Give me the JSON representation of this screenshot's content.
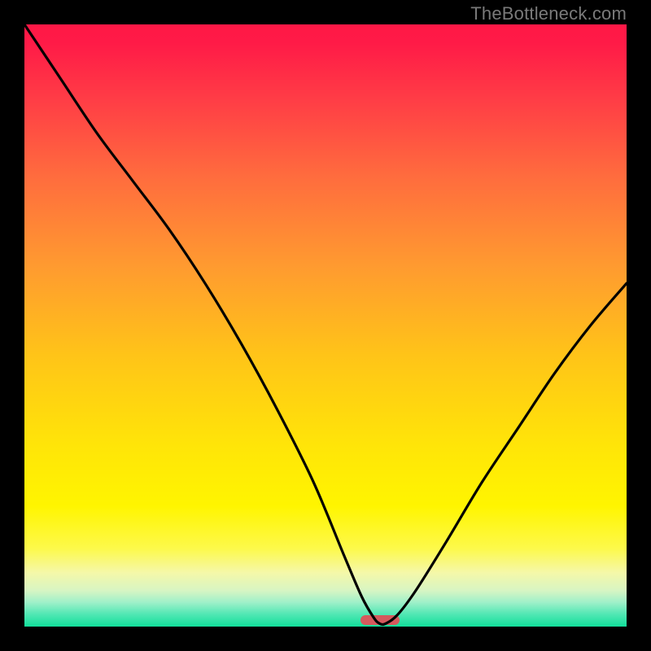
{
  "watermark": "TheBottleneck.com",
  "chart_data": {
    "type": "line",
    "title": "",
    "xlabel": "",
    "ylabel": "",
    "xlim": [
      0,
      100
    ],
    "ylim": [
      0,
      100
    ],
    "grid": false,
    "series": [
      {
        "name": "bottleneck-curve",
        "x": [
          0,
          6,
          12,
          18,
          24,
          30,
          36,
          42,
          48,
          53,
          56,
          58,
          59,
          60,
          62,
          65,
          70,
          76,
          82,
          88,
          94,
          100
        ],
        "y": [
          100,
          91,
          82,
          74,
          66,
          57,
          47,
          36,
          24,
          12,
          5,
          1.5,
          0.5,
          0.5,
          2,
          6,
          14,
          24,
          33,
          42,
          50,
          57
        ]
      }
    ],
    "marker": {
      "x_center": 59,
      "width": 6.5,
      "height": 1.6
    },
    "colors": {
      "curve": "#000000",
      "marker": "#d55a5d",
      "gradient_top": "#ff1846",
      "gradient_bottom": "#12df9b"
    }
  }
}
